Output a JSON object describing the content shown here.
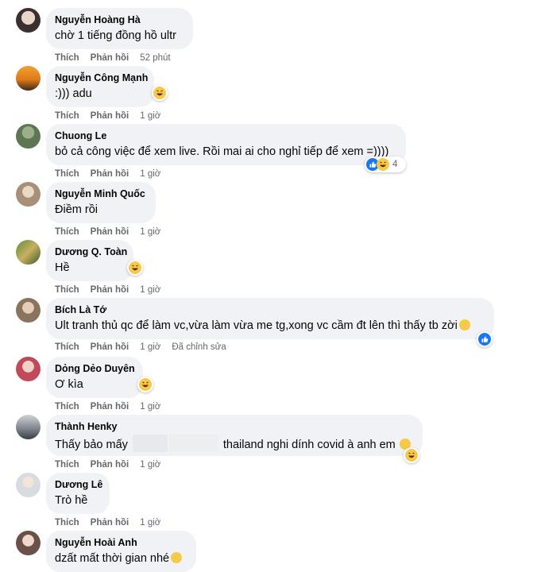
{
  "actions": {
    "like": "Thích",
    "reply": "Phản hồi",
    "edited": "Đã chỉnh sửa"
  },
  "comments": [
    {
      "name": "Nguyễn Hoàng Hà",
      "text": "chờ 1 tiếng đồng hồ ultr",
      "time": "52 phút"
    },
    {
      "name": "Nguyễn Công Mạnh",
      "text": ":))) adu",
      "time": "1 giờ",
      "reaction": "haha-icon"
    },
    {
      "name": "Chuong Le",
      "text": "bỏ cả công việc để xem live. Rồi mai ai cho nghỉ tiếp để xem =))))",
      "time": "1 giờ",
      "reaction": "like-icon + haha-icon",
      "reaction_count": "4"
    },
    {
      "name": "Nguyễn Minh Quốc",
      "text": "Điềm rồi",
      "time": "1 giờ"
    },
    {
      "name": "Dương Q. Toàn",
      "text": "Hề",
      "time": "1 giờ",
      "reaction": "haha-icon"
    },
    {
      "name": "Bích Là Tớ",
      "text": "Ult tranh thủ qc để làm vc,vừa làm vừa me tg,xong vc cầm đt lên thì thấy tb zời",
      "time": "1 giờ",
      "reaction": "like-icon",
      "edited": true
    },
    {
      "name": "Dỏng Dẻo Duyên",
      "text": "Ơ kìa",
      "time": "1 giờ",
      "reaction": "haha-icon"
    },
    {
      "name": "Thành Henky",
      "text_before": "Thấy bảo mấy",
      "text_after": "thailand nghi dính covid à anh em",
      "time": "1 giờ",
      "reaction": "haha-icon"
    },
    {
      "name": "Dương Lê",
      "text": "Trò hề",
      "time": "1 giờ"
    },
    {
      "name": "Nguyễn Hoài Anh",
      "text": "dzất mất thời gian nhé",
      "time": ""
    }
  ],
  "colors": {
    "bubble": "#f0f2f5",
    "meta": "#65676b",
    "like_blue": "#1877f2",
    "emoji_yellow": "#f7c948"
  }
}
